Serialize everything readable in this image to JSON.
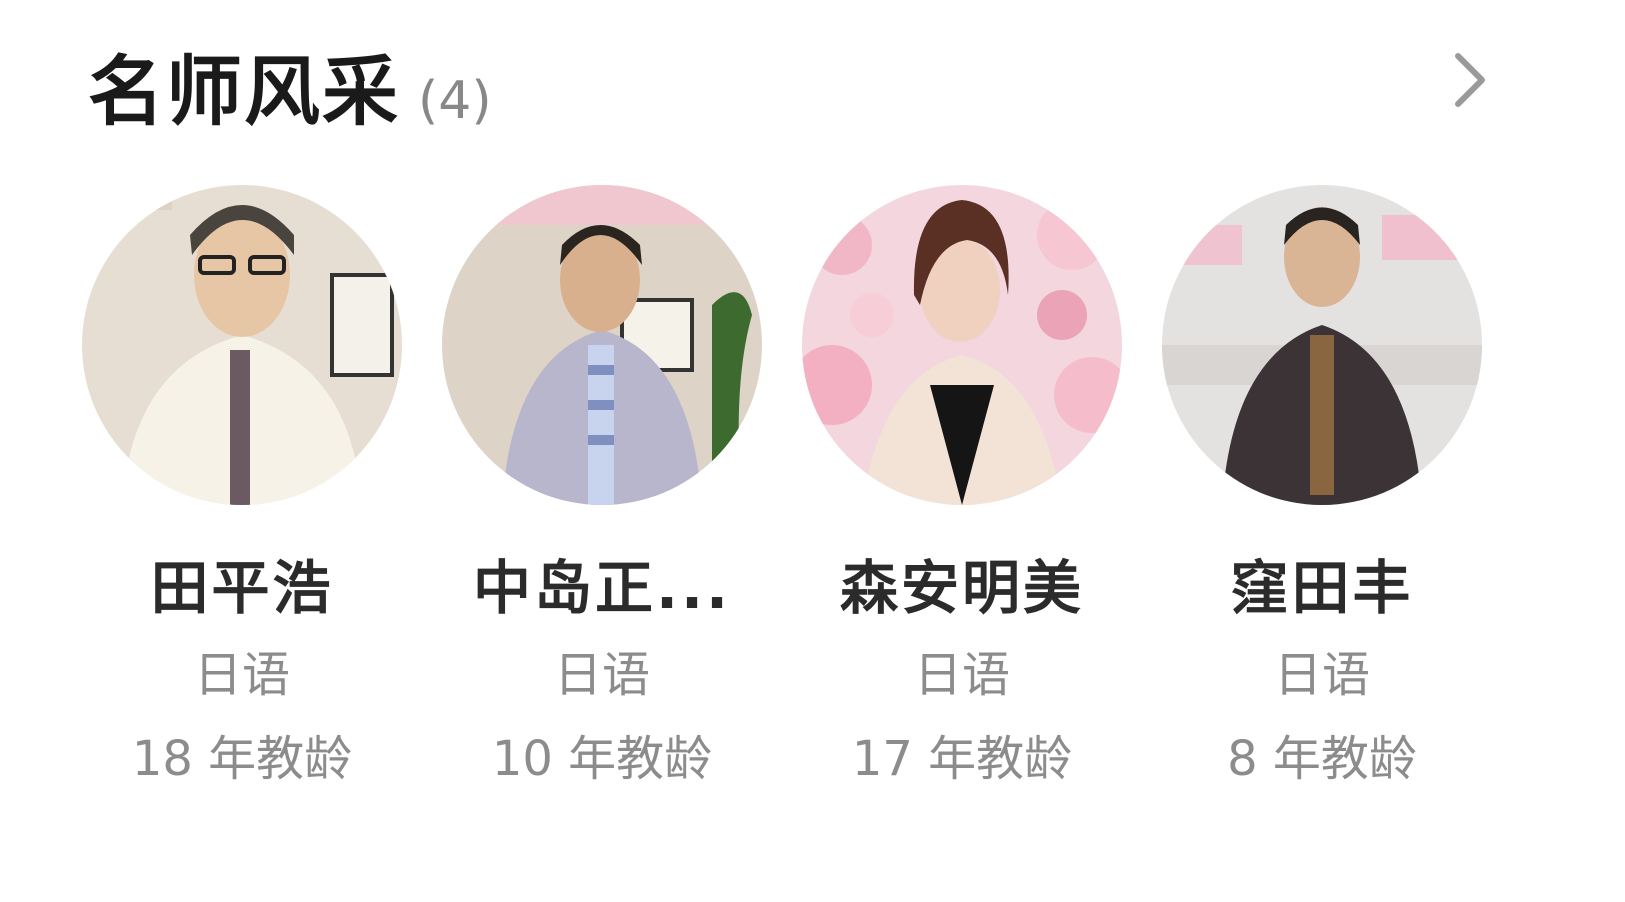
{
  "header": {
    "title": "名师风采",
    "count": "(4)",
    "more_icon": "chevron-right-icon"
  },
  "teachers": [
    {
      "name": "田平浩",
      "subject": "日语",
      "experience": "18 年教龄"
    },
    {
      "name": "中岛正...",
      "subject": "日语",
      "experience": "10 年教龄"
    },
    {
      "name": "森安明美",
      "subject": "日语",
      "experience": "17 年教龄"
    },
    {
      "name": "窪田丰",
      "subject": "日语",
      "experience": "8 年教龄"
    }
  ]
}
